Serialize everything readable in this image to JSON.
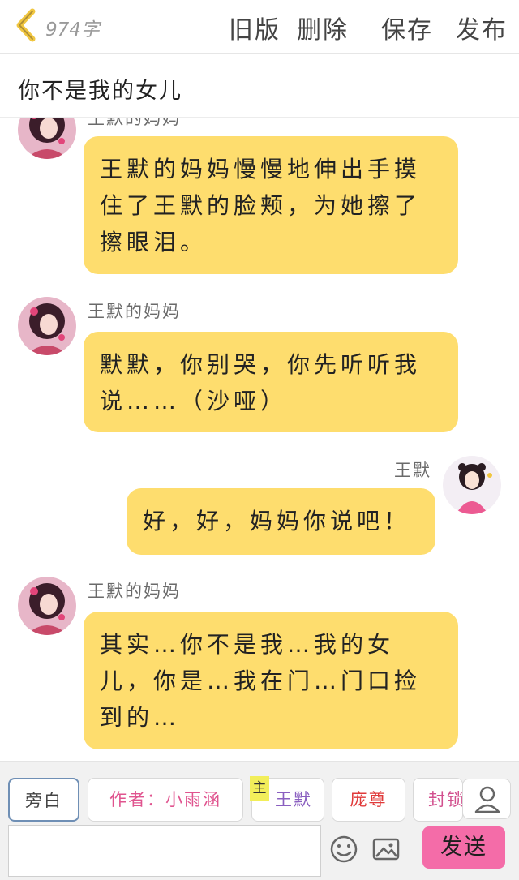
{
  "header": {
    "word_count": "974字",
    "buttons": {
      "old_version": "旧版",
      "delete": "删除",
      "save": "保存",
      "publish": "发布"
    }
  },
  "story_title": "你不是我的女儿",
  "messages": [
    {
      "speaker": "王默的妈妈",
      "side": "left",
      "speaker_visible": false,
      "text": "王默的妈妈慢慢地伸出手摸住了王默的脸颊，为她擦了擦眼泪。"
    },
    {
      "speaker": "王默的妈妈",
      "side": "left",
      "speaker_visible": true,
      "text": "默默，你别哭，你先听听我说……（沙哑）"
    },
    {
      "speaker": "王默",
      "side": "right",
      "speaker_visible": true,
      "text": "好，好，妈妈你说吧！"
    },
    {
      "speaker": "王默的妈妈",
      "side": "left",
      "speaker_visible": true,
      "text": "其实…你不是我…我的女儿，你是…我在门…门口捡到的…"
    }
  ],
  "role_bar": {
    "roles": [
      {
        "label": "旁白",
        "color": "#444444",
        "selected": true
      },
      {
        "label": "作者：小雨涵",
        "color": "#e0548f",
        "selected": false
      },
      {
        "label": "王默",
        "color": "#8a5fc0",
        "selected": false,
        "badge": "主"
      },
      {
        "label": "庞尊",
        "color": "#e03a3a",
        "selected": false
      },
      {
        "label": "封锁",
        "color": "#d2508e",
        "selected": false
      }
    ],
    "input_value": "",
    "send_label": "发送"
  },
  "colors": {
    "bubble": "#fedd6e",
    "send": "#f46ca8",
    "main_badge": "#f2ee5a"
  },
  "icons": [
    "back-chevron-icon",
    "person-icon",
    "emoji-icon",
    "image-icon"
  ]
}
